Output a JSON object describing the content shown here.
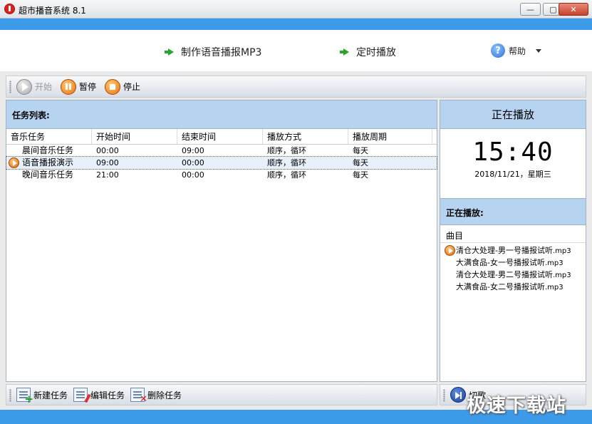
{
  "window": {
    "title": "超市播音系统 8.1",
    "minimize": "—",
    "maximize": "▢",
    "close": "✕"
  },
  "header": {
    "make_mp3": "制作语音播报MP3",
    "scheduled": "定时播放",
    "help": "帮助",
    "help_glyph": "?"
  },
  "toolbar": {
    "start": "开始",
    "pause": "暂停",
    "stop": "停止"
  },
  "tasks": {
    "title": "任务列表:",
    "columns": [
      "音乐任务",
      "开始时间",
      "结束时间",
      "播放方式",
      "播放周期"
    ],
    "rows": [
      [
        "晨间音乐任务",
        "00:00",
        "09:00",
        "顺序，循环",
        "每天"
      ],
      [
        "语音播报演示",
        "09:00",
        "00:00",
        "顺序，循环",
        "每天"
      ],
      [
        "晚间音乐任务",
        "21:00",
        "00:00",
        "顺序，循环",
        "每天"
      ]
    ],
    "selected_index": 1
  },
  "bottom_toolbar": {
    "new_task": "新建任务",
    "edit_task": "编辑任务",
    "delete_task": "删除任务"
  },
  "now_playing": {
    "header": "正在播放",
    "time": "15:40",
    "date": "2018/11/21，星期三",
    "sub_title": "正在播放:",
    "track_column": "曲目",
    "tracks": [
      {
        "name": "清仓大处理-男一号播报试听",
        "ext": ".mp3"
      },
      {
        "name": "大满食品-女一号播报试听",
        "ext": ".mp3"
      },
      {
        "name": "清仓大处理-男二号播报试听",
        "ext": ".mp3"
      },
      {
        "name": "大满食品-女二号播报试听",
        "ext": ".mp3"
      }
    ],
    "playing_index": 0,
    "skip": "切歌"
  },
  "watermark": "极速下载站"
}
